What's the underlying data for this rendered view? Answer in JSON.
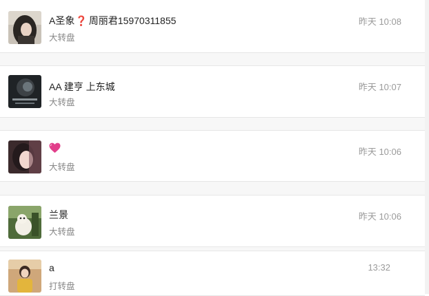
{
  "messages": [
    {
      "name_prefix": "A圣象",
      "name_mark": "❓",
      "name_suffix": "周丽君15970311855",
      "subtitle": "大转盘",
      "time": "昨天 10:08",
      "avatar_icon": "girl-dark-hair-avatar"
    },
    {
      "name": "AA 建亨 上东城",
      "subtitle": "大转盘",
      "time": "昨天 10:07",
      "avatar_icon": "dark-helmet-avatar"
    },
    {
      "name_icon": "pink-heart-icon",
      "subtitle": "大转盘",
      "time": "昨天 10:06",
      "avatar_icon": "girl-selfie-avatar"
    },
    {
      "name": "兰景",
      "subtitle": "大转盘",
      "time": "昨天 10:06",
      "avatar_icon": "dog-outdoor-avatar"
    },
    {
      "name": "a",
      "subtitle": "打转盘",
      "time": "13:32",
      "avatar_icon": "woman-yellow-avatar"
    }
  ],
  "colors": {
    "name": "#222222",
    "subtitle": "#888888",
    "time": "#9a9a9a",
    "separator": "#f7f7f7",
    "heart": "#e23f8b"
  }
}
